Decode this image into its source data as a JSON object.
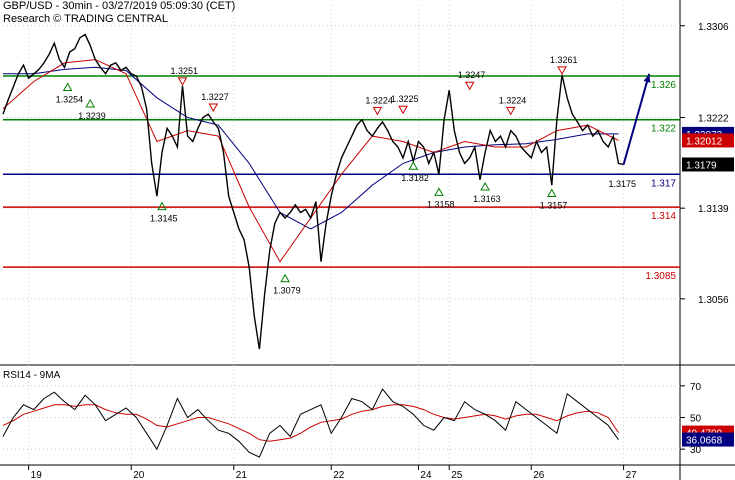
{
  "header": {
    "line1": "GBP/USD - 30min - 03/27/2019 05:09:30 (CET)",
    "line2": "Research © TRADING CENTRAL"
  },
  "rsi_panel": {
    "label": "RSI14 - 9MA"
  },
  "colors": {
    "price": "#000000",
    "ma_fast": "#cc0000",
    "ma_slow": "#000080",
    "resistance": "#008000",
    "support": "#cc0000",
    "pivot": "#000080",
    "arrow": "#000080",
    "grid": "#cccccc"
  },
  "chart_data": {
    "type": "line",
    "title": "GBP/USD - 30min - 03/27/2019 05:09:30 (CET)",
    "x_ticks": [
      "19",
      "20",
      "21",
      "22",
      "24",
      "25",
      "26",
      "27"
    ],
    "y_ticks": [
      "1.3306",
      "1.3222",
      "1.3139",
      "1.3056"
    ],
    "ylim": [
      1.3,
      1.3325
    ],
    "horizontal_levels": [
      {
        "value": 1.326,
        "label": "1.326",
        "role": "resistance"
      },
      {
        "value": 1.322,
        "label": "1.322",
        "role": "resistance"
      },
      {
        "value": 1.317,
        "label": "1.317",
        "role": "pivot"
      },
      {
        "value": 1.314,
        "label": "1.314",
        "role": "support"
      },
      {
        "value": 1.3085,
        "label": "1.3085",
        "role": "support"
      }
    ],
    "price_tags": [
      {
        "label": "1.32073",
        "value": 1.3207,
        "fill": "#000080"
      },
      {
        "label": "1.32012",
        "value": 1.3201,
        "fill": "#cc0000"
      },
      {
        "label": "1.3179",
        "value": 1.3179,
        "fill": "#000000"
      }
    ],
    "annotations": [
      {
        "label": "1.3254",
        "x": 0.63,
        "value": 1.3254,
        "kind": "low"
      },
      {
        "label": "1.3239",
        "x": 0.85,
        "value": 1.3239,
        "kind": "low"
      },
      {
        "label": "1.3251",
        "x": 1.75,
        "value": 1.3251,
        "kind": "high"
      },
      {
        "label": "1.3227",
        "x": 2.05,
        "value": 1.3227,
        "kind": "high"
      },
      {
        "label": "1.3145",
        "x": 1.55,
        "value": 1.3145,
        "kind": "low"
      },
      {
        "label": "1.3079",
        "x": 2.75,
        "value": 1.3079,
        "kind": "low"
      },
      {
        "label": "1.3224",
        "x": 3.65,
        "value": 1.3224,
        "kind": "high"
      },
      {
        "label": "1.3225",
        "x": 3.9,
        "value": 1.3225,
        "kind": "high"
      },
      {
        "label": "1.3182",
        "x": 4.0,
        "value": 1.3182,
        "kind": "low"
      },
      {
        "label": "1.3158",
        "x": 4.25,
        "value": 1.3158,
        "kind": "low"
      },
      {
        "label": "1.3247",
        "x": 4.55,
        "value": 1.3247,
        "kind": "high"
      },
      {
        "label": "1.3163",
        "x": 4.7,
        "value": 1.3163,
        "kind": "low"
      },
      {
        "label": "1.3224",
        "x": 4.95,
        "value": 1.3224,
        "kind": "high"
      },
      {
        "label": "1.3157",
        "x": 5.35,
        "value": 1.3157,
        "kind": "low"
      },
      {
        "label": "1.3261",
        "x": 5.45,
        "value": 1.3261,
        "kind": "high"
      },
      {
        "label": "1.3175",
        "x": 6.0,
        "value": 1.3175,
        "kind": "plain"
      }
    ],
    "x_range": [
      0,
      6.6
    ],
    "price": {
      "x": [
        0.0,
        0.05,
        0.1,
        0.15,
        0.2,
        0.25,
        0.3,
        0.35,
        0.4,
        0.45,
        0.5,
        0.55,
        0.6,
        0.65,
        0.7,
        0.75,
        0.8,
        0.85,
        0.9,
        0.95,
        1.0,
        1.05,
        1.1,
        1.15,
        1.2,
        1.25,
        1.3,
        1.35,
        1.4,
        1.45,
        1.5,
        1.55,
        1.6,
        1.65,
        1.7,
        1.75,
        1.8,
        1.85,
        1.9,
        1.95,
        2.0,
        2.05,
        2.1,
        2.15,
        2.2,
        2.25,
        2.3,
        2.35,
        2.4,
        2.45,
        2.5,
        2.55,
        2.6,
        2.65,
        2.7,
        2.75,
        2.8,
        2.85,
        2.9,
        2.95,
        3.0,
        3.05,
        3.1,
        3.15,
        3.2,
        3.25,
        3.3,
        3.35,
        3.4,
        3.45,
        3.5,
        3.55,
        3.6,
        3.65,
        3.7,
        3.75,
        3.8,
        3.85,
        3.9,
        3.95,
        4.0,
        4.05,
        4.1,
        4.15,
        4.2,
        4.25,
        4.3,
        4.35,
        4.4,
        4.45,
        4.5,
        4.55,
        4.6,
        4.65,
        4.7,
        4.75,
        4.8,
        4.85,
        4.9,
        4.95,
        5.0,
        5.05,
        5.1,
        5.15,
        5.2,
        5.25,
        5.3,
        5.35,
        5.4,
        5.45,
        5.5,
        5.55,
        5.6,
        5.65,
        5.7,
        5.75,
        5.8,
        5.85,
        5.9,
        5.95,
        6.0,
        6.05
      ],
      "y": [
        1.3225,
        1.3238,
        1.325,
        1.3262,
        1.327,
        1.3258,
        1.3262,
        1.3266,
        1.3272,
        1.328,
        1.329,
        1.3275,
        1.3268,
        1.3282,
        1.3285,
        1.3295,
        1.3298,
        1.3288,
        1.3275,
        1.3268,
        1.3262,
        1.327,
        1.3272,
        1.3265,
        1.3268,
        1.3262,
        1.326,
        1.325,
        1.323,
        1.318,
        1.315,
        1.319,
        1.3212,
        1.3205,
        1.3195,
        1.3251,
        1.3205,
        1.32,
        1.3212,
        1.3222,
        1.3225,
        1.3218,
        1.3212,
        1.319,
        1.315,
        1.3135,
        1.312,
        1.311,
        1.3085,
        1.304,
        1.301,
        1.306,
        1.31,
        1.3125,
        1.3135,
        1.313,
        1.3135,
        1.3142,
        1.3135,
        1.3138,
        1.313,
        1.3145,
        1.309,
        1.3125,
        1.315,
        1.317,
        1.3185,
        1.3195,
        1.3205,
        1.3215,
        1.322,
        1.321,
        1.3205,
        1.3212,
        1.3218,
        1.321,
        1.32,
        1.3195,
        1.3185,
        1.32,
        1.3182,
        1.32,
        1.3195,
        1.318,
        1.319,
        1.317,
        1.322,
        1.3247,
        1.321,
        1.319,
        1.318,
        1.3185,
        1.3195,
        1.3165,
        1.319,
        1.321,
        1.32,
        1.3205,
        1.3195,
        1.321,
        1.3205,
        1.3195,
        1.319,
        1.3185,
        1.32,
        1.319,
        1.3195,
        1.316,
        1.322,
        1.3261,
        1.324,
        1.3225,
        1.3218,
        1.321,
        1.3215,
        1.3205,
        1.321,
        1.32,
        1.3195,
        1.3205,
        1.318,
        1.3179
      ]
    },
    "ma_fast": {
      "x": [
        0.0,
        0.3,
        0.6,
        0.9,
        1.2,
        1.5,
        1.8,
        2.1,
        2.4,
        2.7,
        3.0,
        3.3,
        3.6,
        3.9,
        4.2,
        4.5,
        4.8,
        5.1,
        5.4,
        5.7,
        6.0
      ],
      "y": [
        1.323,
        1.3255,
        1.3272,
        1.3275,
        1.3262,
        1.32,
        1.321,
        1.3205,
        1.314,
        1.309,
        1.313,
        1.317,
        1.3205,
        1.32,
        1.319,
        1.32,
        1.3195,
        1.3195,
        1.321,
        1.3215,
        1.3201
      ]
    },
    "ma_slow": {
      "x": [
        0.0,
        0.3,
        0.6,
        0.9,
        1.2,
        1.5,
        1.8,
        2.1,
        2.4,
        2.7,
        3.0,
        3.3,
        3.6,
        3.9,
        4.2,
        4.5,
        4.8,
        5.1,
        5.4,
        5.7,
        6.0
      ],
      "y": [
        1.3262,
        1.3262,
        1.3266,
        1.3268,
        1.3265,
        1.324,
        1.3222,
        1.3215,
        1.318,
        1.3135,
        1.312,
        1.3135,
        1.316,
        1.318,
        1.319,
        1.3195,
        1.3197,
        1.3198,
        1.3202,
        1.3207,
        1.3207
      ]
    },
    "projection": {
      "x": [
        6.05,
        6.3
      ],
      "y": [
        1.3179,
        1.3262
      ]
    },
    "rsi": {
      "label": "RSI14 - 9MA",
      "y_ticks": [
        "70",
        "50",
        "30"
      ],
      "ylim": [
        20,
        80
      ],
      "value_tags": [
        {
          "label": "40.4709",
          "value": 40.47,
          "fill": "#cc0000"
        },
        {
          "label": "36.0668",
          "value": 36.07,
          "fill": "#000080"
        }
      ],
      "x": [
        0.0,
        0.1,
        0.2,
        0.3,
        0.4,
        0.5,
        0.6,
        0.7,
        0.8,
        0.9,
        1.0,
        1.1,
        1.2,
        1.3,
        1.4,
        1.5,
        1.6,
        1.7,
        1.8,
        1.9,
        2.0,
        2.1,
        2.2,
        2.3,
        2.4,
        2.5,
        2.6,
        2.7,
        2.8,
        2.9,
        3.0,
        3.1,
        3.2,
        3.3,
        3.4,
        3.5,
        3.6,
        3.7,
        3.8,
        3.9,
        4.0,
        4.1,
        4.2,
        4.3,
        4.4,
        4.5,
        4.6,
        4.7,
        4.8,
        4.9,
        5.0,
        5.1,
        5.2,
        5.3,
        5.4,
        5.5,
        5.6,
        5.7,
        5.8,
        5.9,
        6.0
      ],
      "values": [
        38,
        50,
        58,
        55,
        62,
        66,
        60,
        55,
        64,
        58,
        48,
        52,
        56,
        50,
        40,
        30,
        45,
        62,
        50,
        55,
        48,
        42,
        40,
        35,
        28,
        25,
        40,
        45,
        38,
        52,
        55,
        58,
        40,
        50,
        62,
        60,
        55,
        68,
        60,
        57,
        52,
        45,
        42,
        50,
        48,
        60,
        55,
        52,
        48,
        42,
        60,
        55,
        50,
        45,
        40,
        65,
        60,
        55,
        50,
        45,
        36
      ],
      "ma": [
        45,
        48,
        52,
        54,
        56,
        58,
        58,
        57,
        58,
        58,
        55,
        53,
        52,
        52,
        49,
        45,
        44,
        46,
        48,
        50,
        50,
        48,
        46,
        43,
        40,
        36,
        35,
        36,
        37,
        40,
        44,
        47,
        48,
        49,
        52,
        54,
        55,
        57,
        58,
        58,
        57,
        55,
        52,
        50,
        49,
        50,
        51,
        52,
        51,
        49,
        51,
        52,
        52,
        50,
        48,
        51,
        53,
        54,
        53,
        50,
        40.47
      ]
    }
  }
}
